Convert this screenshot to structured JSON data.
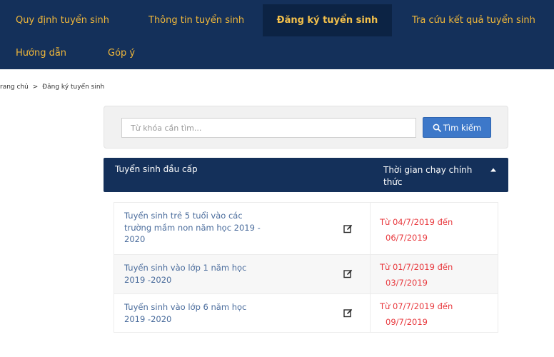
{
  "nav": {
    "items": [
      {
        "label": "Quy định tuyển sinh",
        "active": false
      },
      {
        "label": "Thông tin tuyển sinh",
        "active": false
      },
      {
        "label": "Đăng ký tuyển sinh",
        "active": true
      },
      {
        "label": "Tra cứu kết quả tuyển sinh",
        "active": false
      },
      {
        "label": "Hướng dẫn",
        "active": false
      },
      {
        "label": "Góp ý",
        "active": false
      }
    ]
  },
  "breadcrumb": {
    "home": "rang chủ",
    "separator": ">",
    "current": "Đăng ký tuyển sinh"
  },
  "search": {
    "placeholder": "Từ khóa cần tìm...",
    "value": "",
    "button_label": "Tìm kiếm",
    "button_icon": "search-icon"
  },
  "table": {
    "header": {
      "title": "Tuyển sinh đầu cấp",
      "time": "Thời gian chạy chính thức",
      "sort_icon": "caret-up-icon"
    },
    "rows": [
      {
        "name": "Tuyển sinh trẻ 5 tuổi vào các trường mầm non năm học 2019 - 2020",
        "from": "Từ 04/7/2019 đến",
        "to": "06/7/2019"
      },
      {
        "name": "Tuyển sinh vào lớp 1 năm học 2019 -2020",
        "from": "Từ 01/7/2019 đến",
        "to": "03/7/2019"
      },
      {
        "name": "Tuyển sinh vào lớp 6 năm học 2019 -2020",
        "from": "Từ 07/7/2019 đến",
        "to": "09/7/2019"
      }
    ],
    "edit_icon": "edit-icon"
  },
  "colors": {
    "nav_bg": "#14305a",
    "nav_text": "#f0b73a",
    "button_bg": "#3d78c9",
    "link": "#4a6c9c",
    "date_red": "#e8383d"
  }
}
